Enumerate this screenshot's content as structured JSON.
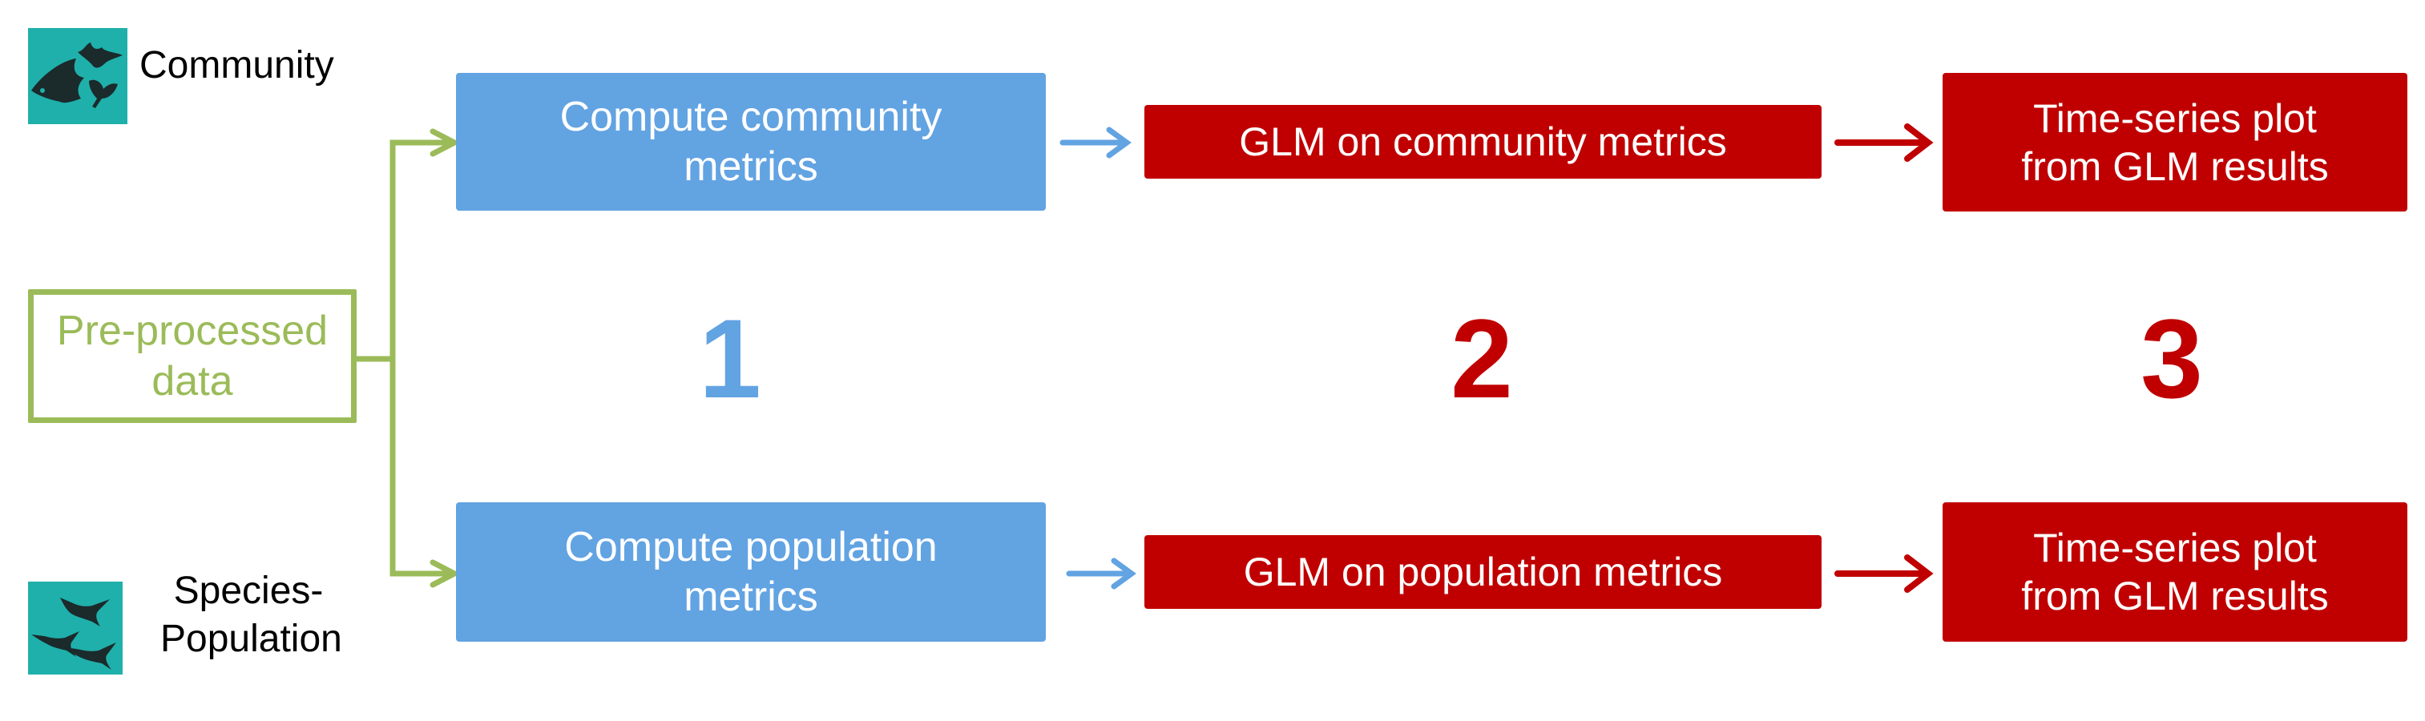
{
  "legend": {
    "community": {
      "label": "Community",
      "icon": "fish-community-icon"
    },
    "population": {
      "label_line1": "Species-",
      "label_line2": "Population",
      "icon": "birds-population-icon"
    }
  },
  "input": {
    "label_line1": "Pre-processed",
    "label_line2": "data"
  },
  "steps": [
    {
      "number": "1",
      "top": "Compute community\nmetrics",
      "bottom": "Compute population\nmetrics"
    },
    {
      "number": "2",
      "top": "GLM on community metrics",
      "bottom": "GLM on population metrics"
    },
    {
      "number": "3",
      "top": "Time-series plot\nfrom GLM results",
      "bottom": "Time-series plot\nfrom GLM results"
    }
  ],
  "colors": {
    "green": "#9bbb59",
    "blue": "#62a3e2",
    "red": "#c00000",
    "teal": "#1fb0ab",
    "icon_dark": "#1b2a2b"
  }
}
